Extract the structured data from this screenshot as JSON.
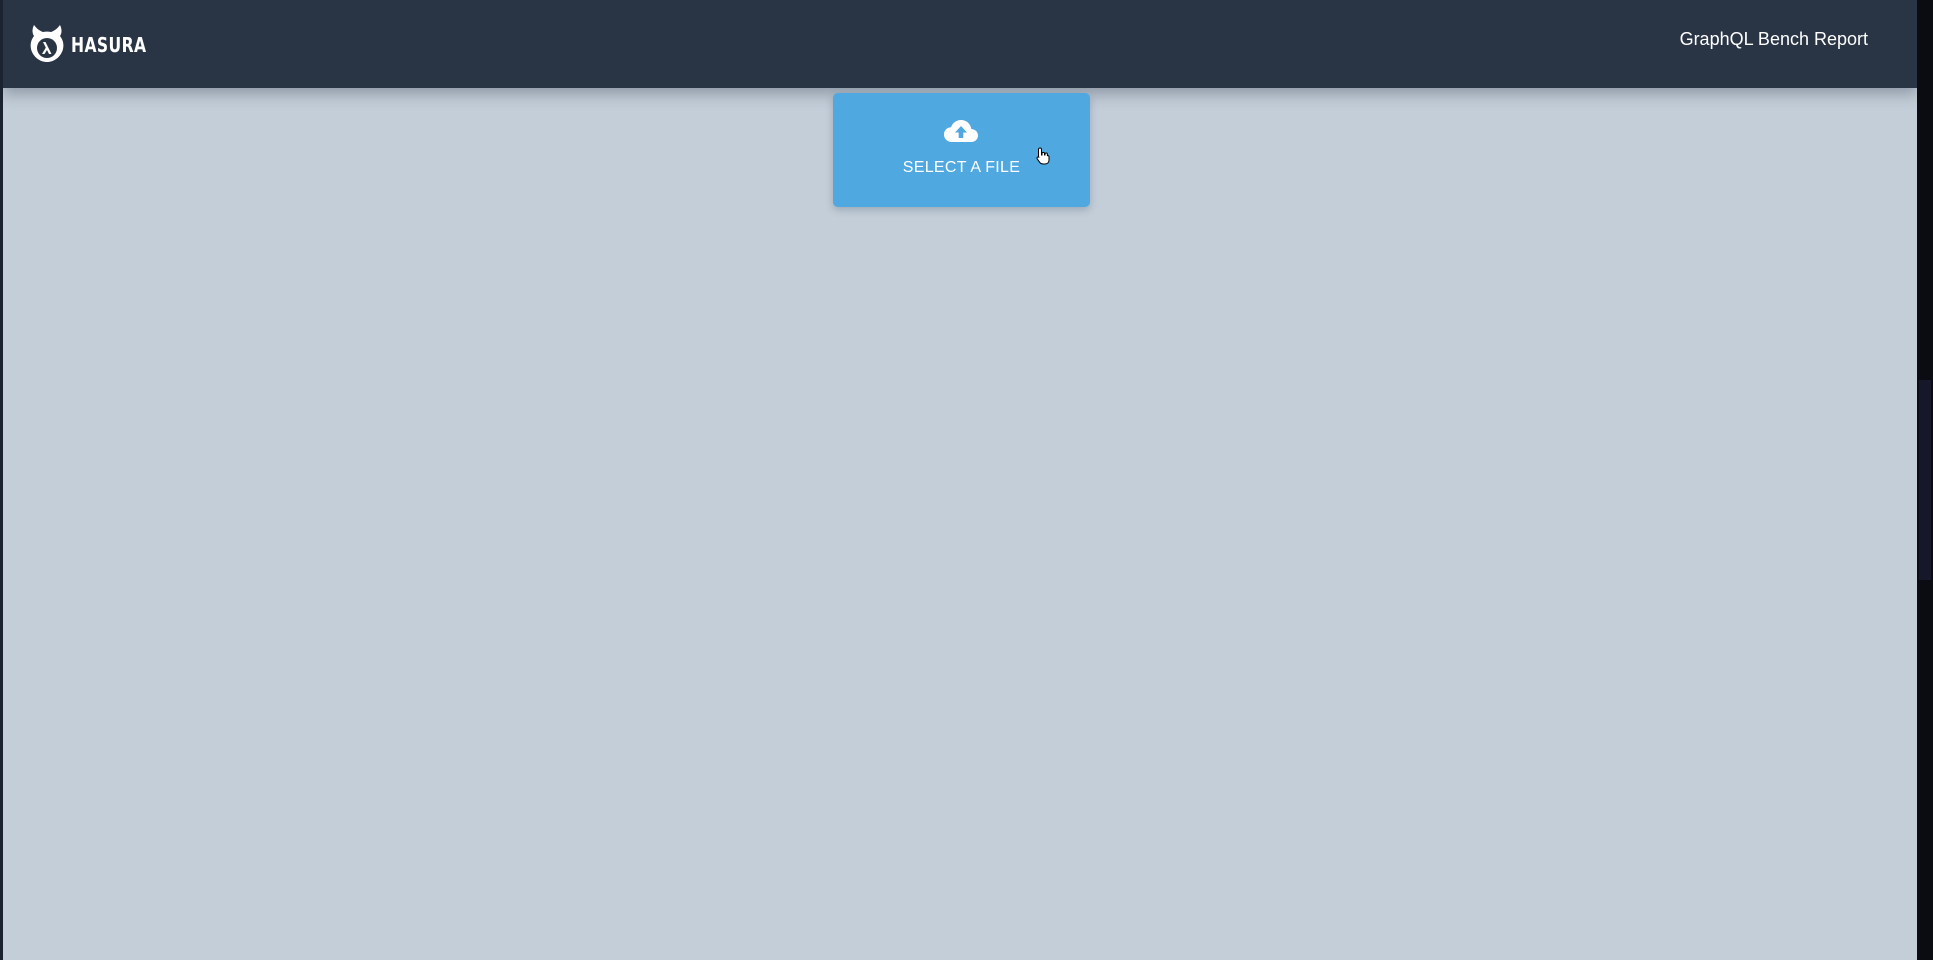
{
  "header": {
    "brand_name": "HASURA",
    "brand_icon": "hasura-logo-icon",
    "title": "GraphQL Bench Report",
    "background_color": "#293545"
  },
  "main": {
    "background_color": "#c4ced8",
    "upload": {
      "label": "SELECT A FILE",
      "icon": "cloud-upload-icon",
      "color": "#4fa8df"
    }
  }
}
